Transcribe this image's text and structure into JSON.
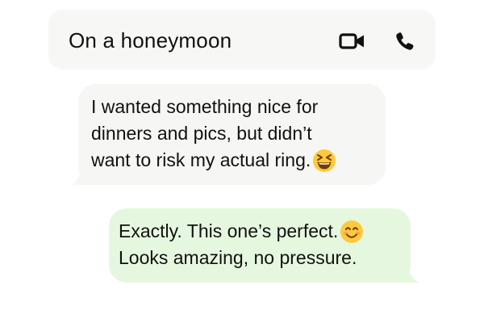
{
  "header": {
    "title": "On a honeymoon",
    "icons": [
      "video-call-icon",
      "phone-call-icon"
    ]
  },
  "messages": [
    {
      "direction": "incoming",
      "lines": [
        "I wanted something nice for",
        "dinners and pics, but didn’t",
        "want to risk my actual ring."
      ],
      "emoji": "grinning-squinting-face-emoji"
    },
    {
      "direction": "outgoing",
      "lines": [
        "Exactly. This one’s perfect.",
        "Looks amazing, no pressure."
      ],
      "emoji": "smiling-face-emoji"
    }
  ],
  "colors": {
    "header_bg": "#f7f7f5",
    "incoming_bubble": "#f6f6f4",
    "outgoing_bubble": "#e6f7df",
    "emoji_yellow": "#ffca3a",
    "emoji_dark": "#6b3e0a"
  }
}
